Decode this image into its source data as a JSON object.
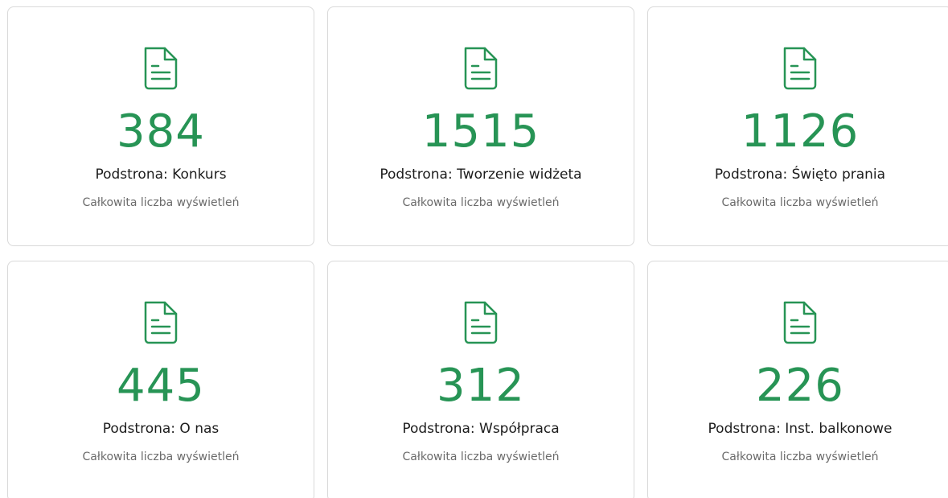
{
  "theme": {
    "accent": "#279455",
    "border": "#d9d9d9",
    "text": "#1c1c1c",
    "muted": "#6b6b6b"
  },
  "cards": [
    {
      "icon": "document-icon",
      "count": "384",
      "title": "Podstrona: Konkurs",
      "subtitle": "Całkowita liczba wyświetleń"
    },
    {
      "icon": "document-icon",
      "count": "1515",
      "title": "Podstrona: Tworzenie widżeta",
      "subtitle": "Całkowita liczba wyświetleń"
    },
    {
      "icon": "document-icon",
      "count": "1126",
      "title": "Podstrona: Święto prania",
      "subtitle": "Całkowita liczba wyświetleń"
    },
    {
      "icon": "document-icon",
      "count": "445",
      "title": "Podstrona: O nas",
      "subtitle": "Całkowita liczba wyświetleń"
    },
    {
      "icon": "document-icon",
      "count": "312",
      "title": "Podstrona: Współpraca",
      "subtitle": "Całkowita liczba wyświetleń"
    },
    {
      "icon": "document-icon",
      "count": "226",
      "title": "Podstrona: Inst. balkonowe",
      "subtitle": "Całkowita liczba wyświetleń"
    }
  ]
}
